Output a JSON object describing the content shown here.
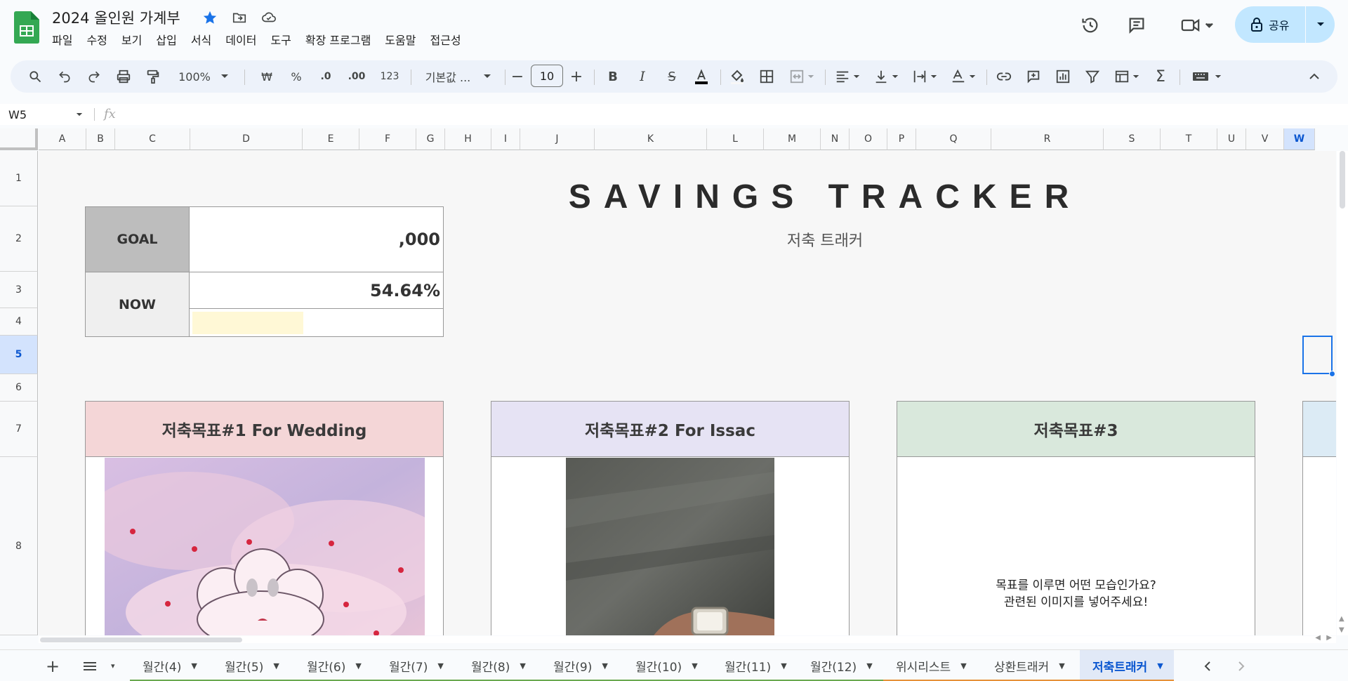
{
  "doc": {
    "title": "2024 올인원 가계부"
  },
  "menu": [
    "파일",
    "수정",
    "보기",
    "삽입",
    "서식",
    "데이터",
    "도구",
    "확장 프로그램",
    "도움말",
    "접근성"
  ],
  "share": {
    "label": "공유"
  },
  "toolbar": {
    "zoom": "100%",
    "currency": "₩",
    "percent": "%",
    "dec_decrease": ".0",
    "dec_increase": ".00",
    "number_format": "123",
    "font": "기본값 ...",
    "font_size": "10"
  },
  "formula_bar": {
    "cell_ref": "W5",
    "fx": "fx"
  },
  "columns": [
    "A",
    "B",
    "C",
    "D",
    "E",
    "F",
    "G",
    "H",
    "I",
    "J",
    "K",
    "L",
    "M",
    "N",
    "O",
    "P",
    "Q",
    "R",
    "S",
    "T",
    "U",
    "V",
    "W"
  ],
  "active_column": "W",
  "rows": [
    "1",
    "2",
    "3",
    "4",
    "5",
    "6",
    "7",
    "8"
  ],
  "active_row": "5",
  "tracker": {
    "goal_label": "GOAL",
    "goal_value": ",000",
    "now_label": "NOW",
    "now_value": "54.64%",
    "progress": 0.4375,
    "title": "SAVINGS TRACKER",
    "subtitle": "저축 트래커"
  },
  "goals": [
    {
      "header": "저축목표#1 For Wedding",
      "color": "#f4d6d7"
    },
    {
      "header": "저축목표#2 For Issac",
      "color": "#e6e3f4"
    },
    {
      "header": "저축목표#3",
      "color": "#d9e8dc",
      "placeholder_line1": "목표를 이루면 어떤 모습인가요?",
      "placeholder_line2": "관련된 이미지를 넣어주세요!"
    }
  ],
  "sheet_tabs": [
    {
      "label": "월간(4)",
      "underline": "#6aa84f"
    },
    {
      "label": "월간(5)",
      "underline": "#6aa84f"
    },
    {
      "label": "월간(6)",
      "underline": "#6aa84f"
    },
    {
      "label": "월간(7)",
      "underline": "#6aa84f"
    },
    {
      "label": "월간(8)",
      "underline": "#6aa84f"
    },
    {
      "label": "월간(9)",
      "underline": "#6aa84f"
    },
    {
      "label": "월간(10)",
      "underline": "#6aa84f"
    },
    {
      "label": "월간(11)",
      "underline": "#6aa84f"
    },
    {
      "label": "월간(12)",
      "underline": "#6aa84f"
    },
    {
      "label": "위시리스트",
      "underline": "#e69138"
    },
    {
      "label": "상환트래커",
      "underline": "#e69138"
    },
    {
      "label": "저축트래커",
      "underline": "#e69138",
      "active": true
    }
  ],
  "colors": {
    "accent": "#1a73e8",
    "share_bg": "#c2e7ff",
    "toolbar_bg": "#edf2fa"
  }
}
